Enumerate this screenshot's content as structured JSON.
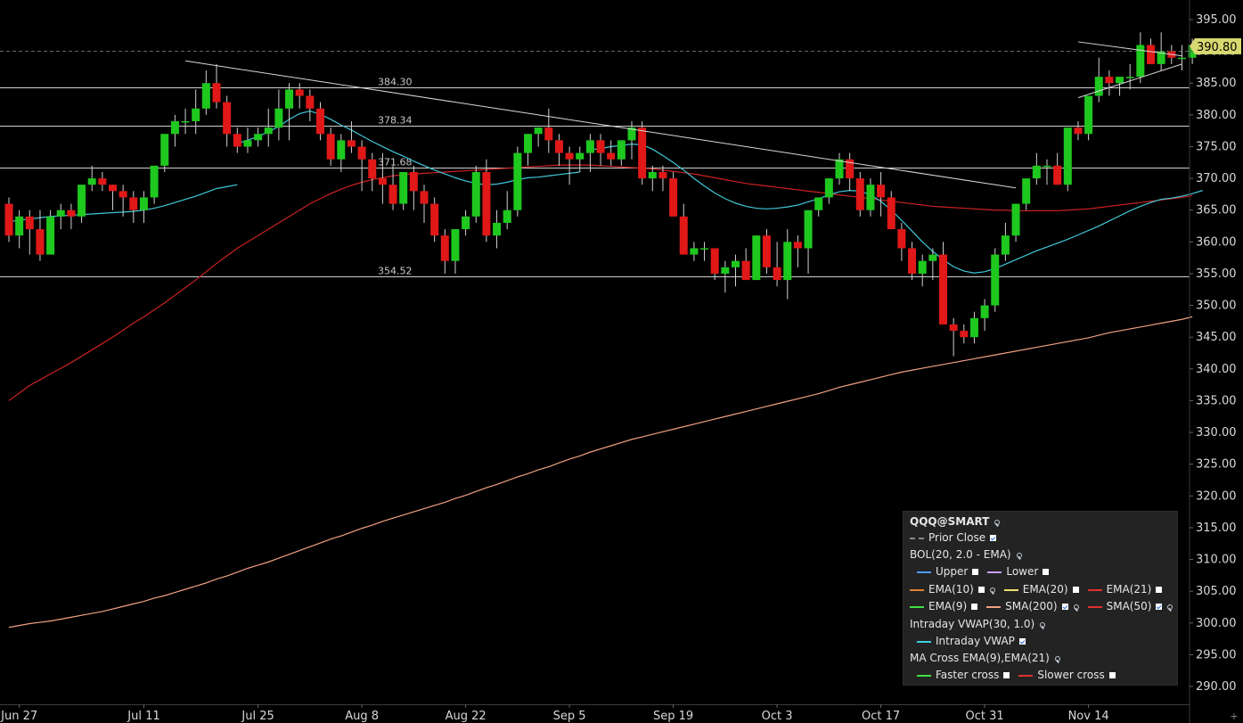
{
  "chart_data": {
    "type": "candlestick",
    "symbol": "QQQ@SMART",
    "ylim": [
      287,
      397
    ],
    "y_ticks": [
      "395.00",
      "390.00",
      "385.00",
      "380.00",
      "375.00",
      "370.00",
      "365.00",
      "360.00",
      "355.00",
      "350.00",
      "345.00",
      "340.00",
      "335.00",
      "330.00",
      "325.00",
      "320.00",
      "315.00",
      "310.00",
      "305.00",
      "300.00",
      "295.00",
      "290.00"
    ],
    "x_labels": [
      "Jun 27",
      "Jul 11",
      "Jul 25",
      "Aug 8",
      "Aug 22",
      "Sep 5",
      "Sep 19",
      "Oct 3",
      "Oct 17",
      "Oct 31",
      "Nov 14"
    ],
    "x_label_index": [
      1,
      13,
      24,
      34,
      44,
      54,
      64,
      74,
      84,
      94,
      104
    ],
    "last_price": "390.80",
    "prior_close": 390.1,
    "horizontal_levels": [
      {
        "value": 384.3,
        "label": "384.30"
      },
      {
        "value": 378.34,
        "label": "378.34"
      },
      {
        "value": 371.68,
        "label": "371.68"
      },
      {
        "value": 354.52,
        "label": "354.52"
      }
    ],
    "candles": [
      [
        366,
        367,
        360,
        361
      ],
      [
        361,
        365,
        359,
        364
      ],
      [
        364,
        365,
        358,
        362
      ],
      [
        362,
        365,
        357,
        358
      ],
      [
        358,
        365,
        358,
        364
      ],
      [
        364,
        366,
        362,
        365
      ],
      [
        365,
        366,
        362,
        364
      ],
      [
        364,
        369,
        363,
        369
      ],
      [
        369,
        372,
        368,
        370
      ],
      [
        370,
        371,
        368,
        369
      ],
      [
        369,
        369,
        365,
        368
      ],
      [
        368,
        369,
        364,
        367
      ],
      [
        367,
        368,
        363,
        365
      ],
      [
        365,
        368,
        363,
        367
      ],
      [
        367,
        372,
        366,
        372
      ],
      [
        372,
        377,
        371,
        377
      ],
      [
        377,
        380,
        375,
        379
      ],
      [
        379,
        381,
        377,
        379
      ],
      [
        379,
        384,
        377,
        381
      ],
      [
        381,
        387,
        380,
        385
      ],
      [
        385,
        388,
        381,
        382
      ],
      [
        382,
        383,
        375,
        377
      ],
      [
        377,
        378,
        374,
        375
      ],
      [
        375,
        378,
        374,
        376
      ],
      [
        376,
        378,
        375,
        377
      ],
      [
        377,
        381,
        375,
        378
      ],
      [
        378,
        384,
        376,
        381
      ],
      [
        381,
        385,
        376,
        384
      ],
      [
        384,
        385,
        381,
        383
      ],
      [
        383,
        384,
        379,
        381
      ],
      [
        381,
        382,
        376,
        377
      ],
      [
        377,
        378,
        372,
        373
      ],
      [
        373,
        377,
        371,
        376
      ],
      [
        376,
        379,
        374,
        375
      ],
      [
        375,
        376,
        368,
        373
      ],
      [
        373,
        374,
        368,
        370
      ],
      [
        370,
        374,
        366,
        369
      ],
      [
        369,
        372,
        365,
        366
      ],
      [
        366,
        371,
        365,
        371
      ],
      [
        371,
        372,
        365,
        368
      ],
      [
        368,
        369,
        363,
        366
      ],
      [
        366,
        367,
        360,
        361
      ],
      [
        361,
        362,
        355,
        357
      ],
      [
        357,
        359,
        355,
        362
      ],
      [
        362,
        365,
        361,
        364
      ],
      [
        364,
        372,
        363,
        371
      ],
      [
        371,
        373,
        360,
        361
      ],
      [
        361,
        365,
        359,
        363
      ],
      [
        363,
        368,
        362,
        365
      ],
      [
        365,
        375,
        364,
        374
      ],
      [
        374,
        377,
        372,
        377
      ],
      [
        377,
        378,
        375,
        378
      ],
      [
        378,
        381,
        374,
        376
      ],
      [
        376,
        377,
        372,
        374
      ],
      [
        374,
        375,
        369,
        373
      ],
      [
        373,
        375,
        371,
        374
      ],
      [
        374,
        377,
        371,
        376
      ],
      [
        376,
        377,
        372,
        374
      ],
      [
        374,
        376,
        372,
        373
      ],
      [
        373,
        376,
        372,
        376
      ],
      [
        376,
        379,
        373,
        378
      ],
      [
        378,
        379,
        369,
        370
      ],
      [
        370,
        372,
        368,
        371
      ],
      [
        371,
        372,
        368,
        370
      ],
      [
        370,
        371,
        364,
        364
      ],
      [
        364,
        366,
        358,
        358
      ],
      [
        358,
        360,
        357,
        359
      ],
      [
        359,
        360,
        357,
        359
      ],
      [
        359,
        359,
        354,
        355
      ],
      [
        355,
        357,
        352,
        356
      ],
      [
        356,
        358,
        353,
        357
      ],
      [
        357,
        359,
        355,
        354
      ],
      [
        354,
        361,
        354,
        361
      ],
      [
        361,
        362,
        355,
        356
      ],
      [
        356,
        360,
        353,
        354
      ],
      [
        354,
        362,
        351,
        360
      ],
      [
        360,
        361,
        356,
        359
      ],
      [
        359,
        364,
        355,
        365
      ],
      [
        365,
        367,
        364,
        367
      ],
      [
        367,
        370,
        366,
        370
      ],
      [
        370,
        374,
        369,
        373
      ],
      [
        373,
        374,
        368,
        370
      ],
      [
        370,
        371,
        364,
        365
      ],
      [
        365,
        370,
        364,
        369
      ],
      [
        369,
        371,
        364,
        367
      ],
      [
        367,
        368,
        362,
        362
      ],
      [
        362,
        363,
        357,
        359
      ],
      [
        359,
        360,
        354,
        355
      ],
      [
        355,
        358,
        353,
        357
      ],
      [
        357,
        359,
        354,
        358
      ],
      [
        358,
        360,
        350,
        347
      ],
      [
        347,
        348,
        342,
        346
      ],
      [
        346,
        347,
        344,
        345
      ],
      [
        345,
        349,
        344,
        348
      ],
      [
        348,
        351,
        346,
        350
      ],
      [
        350,
        359,
        349,
        358
      ],
      [
        358,
        363,
        357,
        361
      ],
      [
        361,
        366,
        360,
        366
      ],
      [
        366,
        369,
        365,
        370
      ],
      [
        370,
        374,
        369,
        372
      ],
      [
        372,
        373,
        369,
        372
      ],
      [
        372,
        374,
        369,
        369
      ],
      [
        369,
        378,
        368,
        378
      ],
      [
        378,
        379,
        376,
        377
      ],
      [
        377,
        382,
        376,
        383
      ],
      [
        383,
        389,
        382,
        386
      ],
      [
        386,
        387,
        383,
        385
      ],
      [
        385,
        386,
        383,
        386
      ],
      [
        386,
        388,
        384,
        386
      ],
      [
        386,
        393,
        385,
        391
      ],
      [
        391,
        392,
        388,
        388
      ],
      [
        388,
        393,
        387,
        390
      ],
      [
        390,
        391,
        388,
        389
      ],
      [
        389,
        391,
        387,
        389
      ],
      [
        389,
        392,
        388,
        391
      ]
    ],
    "series": [
      {
        "name": "SMA(200)",
        "color": "#f0a080",
        "values_start": 0,
        "values": [
          299.3,
          299.6,
          299.9,
          300.1,
          300.3,
          300.6,
          300.9,
          301.2,
          301.5,
          301.8,
          302.2,
          302.6,
          303.0,
          303.4,
          303.9,
          304.3,
          304.8,
          305.3,
          305.8,
          306.3,
          306.9,
          307.4,
          308.0,
          308.6,
          309.1,
          309.6,
          310.2,
          310.8,
          311.4,
          312.0,
          312.6,
          313.2,
          313.7,
          314.3,
          314.9,
          315.4,
          316.0,
          316.5,
          317.0,
          317.5,
          318.0,
          318.5,
          319.0,
          319.6,
          320.1,
          320.7,
          321.3,
          321.8,
          322.4,
          323.0,
          323.5,
          324.1,
          324.6,
          325.2,
          325.8,
          326.3,
          326.9,
          327.4,
          327.9,
          328.4,
          328.9,
          329.3,
          329.7,
          330.1,
          330.5,
          330.9,
          331.3,
          331.7,
          332.1,
          332.5,
          332.9,
          333.3,
          333.7,
          334.1,
          334.5,
          334.9,
          335.3,
          335.7,
          336.1,
          336.6,
          337.1,
          337.5,
          337.9,
          338.3,
          338.7,
          339.1,
          339.5,
          339.8,
          340.1,
          340.4,
          340.7,
          341.0,
          341.3,
          341.6,
          341.9,
          342.2,
          342.5,
          342.8,
          343.1,
          343.4,
          343.7,
          344.0,
          344.3,
          344.6,
          344.9,
          345.3,
          345.7,
          346.0,
          346.3,
          346.6,
          346.9,
          347.2,
          347.5,
          347.8,
          348.2
        ]
      },
      {
        "name": "SMA(50)",
        "color": "#cc2222",
        "values_start": 0,
        "values": [
          335.0,
          336.2,
          337.4,
          338.3,
          339.2,
          340.1,
          341.0,
          342.0,
          343.0,
          344.0,
          345.0,
          346.1,
          347.2,
          348.2,
          349.3,
          350.4,
          351.6,
          352.8,
          354.0,
          355.3,
          356.6,
          357.8,
          359.0,
          360.0,
          361.0,
          362.0,
          363.0,
          364.0,
          365.0,
          366.0,
          366.8,
          367.6,
          368.3,
          368.9,
          369.4,
          369.8,
          370.1,
          370.4,
          370.6,
          370.7,
          370.8,
          370.9,
          371.0,
          371.1,
          371.2,
          371.3,
          371.4,
          371.5,
          371.6,
          371.7,
          371.8,
          371.9,
          372.0,
          372.1,
          372.1,
          372.1,
          372.1,
          372.0,
          371.9,
          371.8,
          371.7,
          371.6,
          371.5,
          371.3,
          371.1,
          370.9,
          370.7,
          370.4,
          370.1,
          369.8,
          369.5,
          369.2,
          369.0,
          368.8,
          368.6,
          368.4,
          368.2,
          368.0,
          367.8,
          367.6,
          367.4,
          367.2,
          367.0,
          366.8,
          366.6,
          366.4,
          366.2,
          366.0,
          365.8,
          365.6,
          365.5,
          365.4,
          365.3,
          365.2,
          365.1,
          365.0,
          365.0,
          364.9,
          364.9,
          364.9,
          364.9,
          364.9,
          365.0,
          365.1,
          365.2,
          365.4,
          365.6,
          365.8,
          366.0,
          366.2,
          366.4,
          366.6,
          366.8,
          367.0,
          367.3
        ]
      },
      {
        "name": "Intraday VWAP",
        "color": "#40c8d8",
        "segments": [
          {
            "start": 0,
            "values": [
              363.2,
              363.4,
              363.6,
              363.8,
              364.0,
              364.1,
              364.2,
              364.3,
              364.4,
              364.5,
              364.6,
              364.7,
              364.8,
              365.0,
              365.3,
              365.7,
              366.2,
              366.7,
              367.2,
              367.8,
              368.4,
              368.7,
              369.0
            ]
          },
          {
            "start": 22,
            "values": [
              375.5,
              376.0,
              376.6,
              377.3,
              378.2,
              379.3,
              380.2,
              380.6,
              380.1,
              379.3,
              378.4,
              377.6,
              376.7,
              375.8,
              375.0,
              374.2,
              373.5,
              372.7,
              372.0,
              371.3,
              370.7,
              370.1,
              369.6,
              369.2,
              369.0,
              369.1,
              369.4,
              369.8,
              370.1,
              370.2,
              370.4,
              370.6,
              370.8,
              371.0
            ]
          },
          {
            "start": 56,
            "values": [
              374.5,
              374.7,
              375.0,
              375.2,
              375.4,
              375.3,
              374.6,
              373.6,
              372.5,
              371.3,
              370.0,
              368.8,
              367.7,
              366.8,
              366.1,
              365.6,
              365.3,
              365.2,
              365.3,
              365.5,
              365.8,
              366.3,
              366.8,
              367.4,
              367.9,
              368.1,
              368.0,
              367.4,
              366.4,
              365.0,
              363.4,
              361.7,
              360.0,
              358.5,
              357.2,
              356.1,
              355.4,
              355.1,
              355.3,
              355.8,
              356.5,
              357.2,
              357.9,
              358.6,
              359.2,
              359.8,
              360.4,
              361.1,
              361.8,
              362.5,
              363.3,
              364.1,
              364.9,
              365.6,
              366.2,
              366.7,
              366.9,
              367.2,
              367.6,
              368.1
            ]
          }
        ]
      },
      {
        "name": "Trendline",
        "color": "#d8d8d8",
        "lines": [
          {
            "from": [
              17,
              388.5
            ],
            "to": [
              97,
              368.5
            ]
          },
          {
            "from": [
              103,
              391.5
            ],
            "to": [
              113,
              389.3
            ]
          },
          {
            "from": [
              103,
              382.7
            ],
            "to": [
              113,
              388.0
            ]
          }
        ]
      }
    ]
  },
  "legend": {
    "symbol": "QQQ@SMART",
    "prior_close": "Prior Close",
    "bol": "BOL(20, 2.0 - EMA)",
    "upper": "Upper",
    "lower": "Lower",
    "ema10": "EMA(10)",
    "ema20": "EMA(20)",
    "ema21": "EMA(21)",
    "ema9": "EMA(9)",
    "sma200": "SMA(200)",
    "sma50": "SMA(50)",
    "vwap_study": "Intraday VWAP(30, 1.0)",
    "vwap": "Intraday VWAP",
    "macross": "MA Cross EMA(9),EMA(21)",
    "faster": "Faster cross",
    "slower": "Slower cross",
    "colors": {
      "upper": "#4a9fff",
      "lower": "#c8a0ff",
      "ema10": "#e08030",
      "ema20": "#f0e070",
      "ema21": "#e03030",
      "ema9": "#40e040",
      "sma200": "#f0a080",
      "sma50": "#e03030",
      "vwap": "#40d0e0",
      "faster": "#40e040",
      "slower": "#e03030",
      "prior": "#888888"
    }
  }
}
